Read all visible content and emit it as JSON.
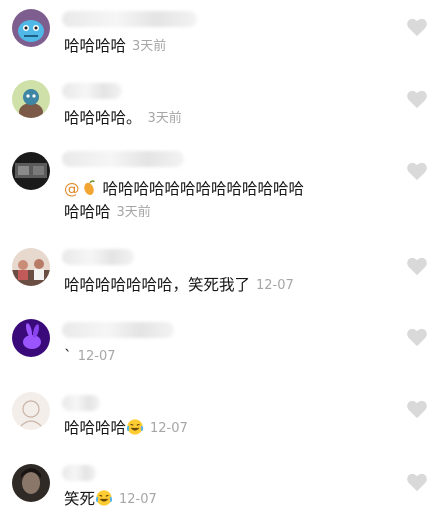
{
  "comments": [
    {
      "text": "哈哈哈哈",
      "time": "3天前",
      "avatar": "blue-alien-avatar"
    },
    {
      "text": "哈哈哈哈。",
      "time": "3天前",
      "avatar": "cartoon-avatar"
    },
    {
      "mention": "@",
      "text_line1": "哈哈哈哈哈哈哈哈哈哈哈哈哈",
      "text_line2": "哈哈哈",
      "time": "3天前",
      "avatar": "dark-photo-avatar"
    },
    {
      "text": "哈哈哈哈哈哈哈，笑死我了",
      "time": "12-07",
      "avatar": "group-photo-avatar"
    },
    {
      "text": "`",
      "time": "12-07",
      "avatar": "purple-rabbit-avatar"
    },
    {
      "text": "哈哈哈哈",
      "emoji": "laughing-tears-emoji",
      "time": "12-07",
      "avatar": "sketch-avatar"
    },
    {
      "text": "笑死",
      "emoji": "laughing-tears-emoji",
      "time": "12-07",
      "avatar": "portrait-avatar"
    }
  ],
  "icons": {
    "like": "heart-outline-icon"
  },
  "colors": {
    "time": "#a6a6a6",
    "heart": "#d9d9d9",
    "text": "#161616"
  }
}
